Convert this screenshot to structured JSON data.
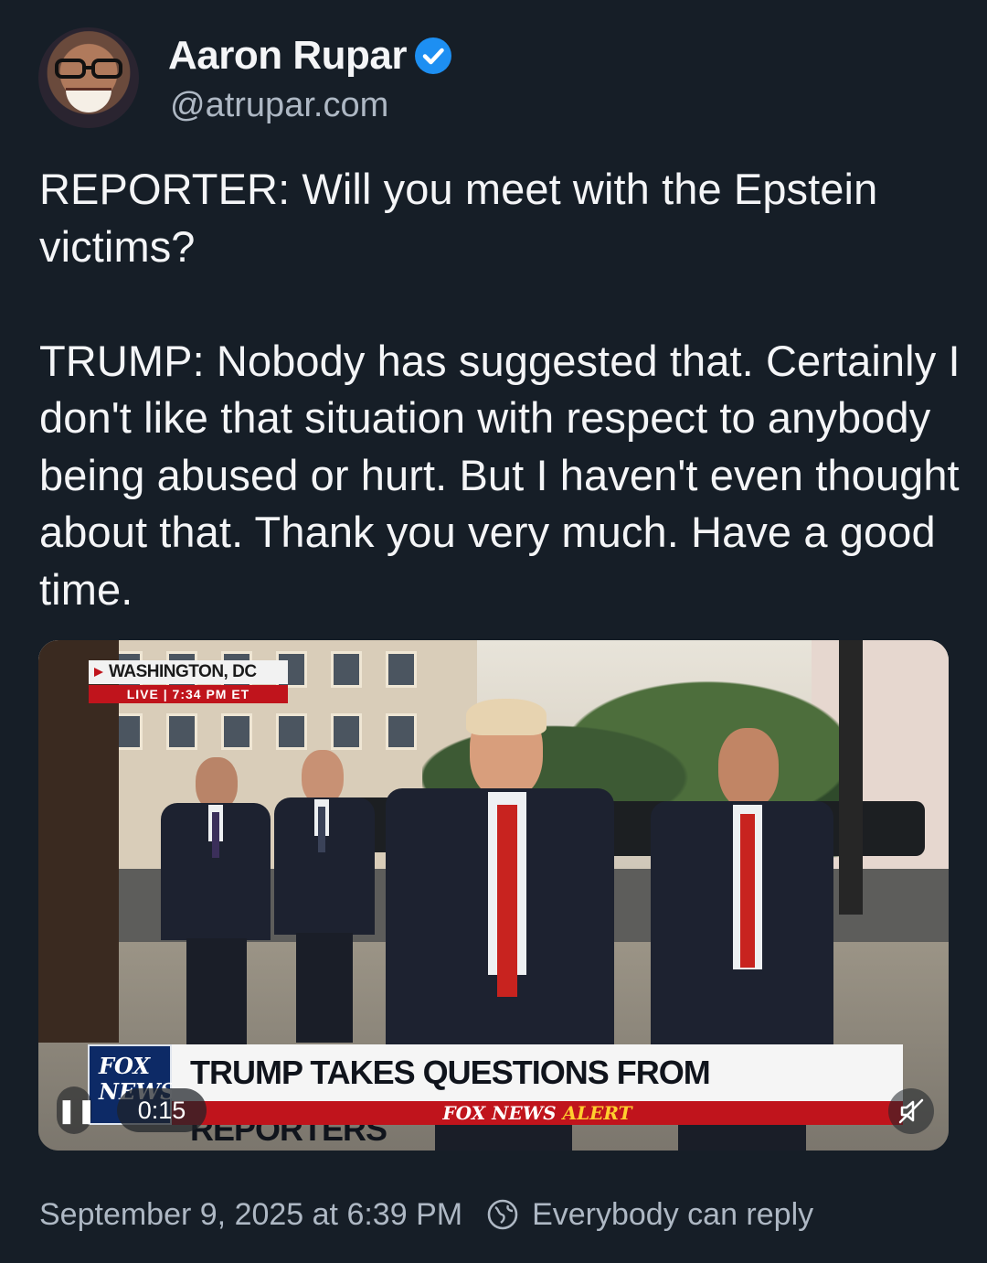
{
  "author": {
    "display_name": "Aaron Rupar",
    "handle": "@atrupar.com",
    "verified": true
  },
  "post": {
    "paragraphs": [
      "REPORTER: Will you meet with the Epstein victims?",
      "TRUMP: Nobody has suggested that. Certainly I don't like that situation with respect to anybody being abused or hurt. But I haven't even thought about that. Thank you very much. Have a good time."
    ]
  },
  "video": {
    "location": "WASHINGTON, DC",
    "live_label": "LIVE | 7:34 PM ET",
    "logo_text": "FOX NEWS",
    "headline": "TRUMP TAKES QUESTIONS FROM REPORTERS",
    "alert_prefix": "FOX NEWS",
    "alert_suffix": "ALERT",
    "elapsed": "0:15",
    "pause_icon": "pause-icon",
    "mute_icon": "muted-speaker-icon"
  },
  "footer": {
    "timestamp": "September 9, 2025 at 6:39 PM",
    "reply_setting": "Everybody can reply",
    "reply_icon": "globe-icon"
  },
  "colors": {
    "background": "#161e27",
    "text": "#f4f5f7",
    "muted_text": "#aeb8c4",
    "verified": "#1d8ff2",
    "fox_red": "#c0141c"
  }
}
